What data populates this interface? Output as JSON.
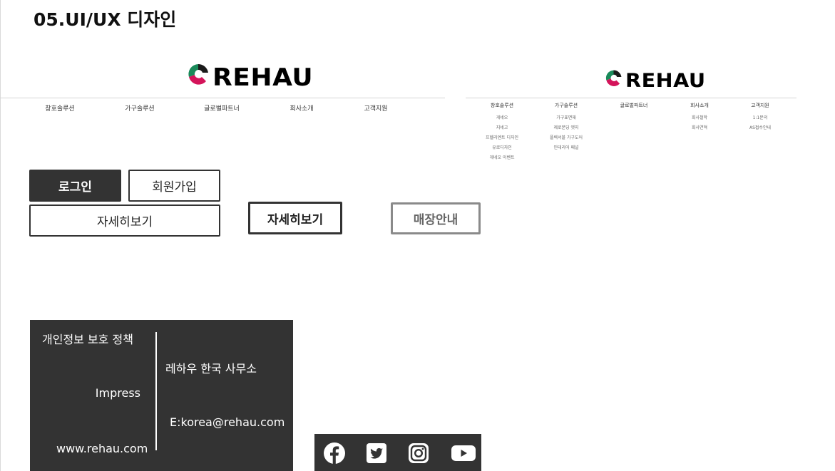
{
  "page": {
    "title": "05.UI/UX 디자인"
  },
  "brand": {
    "name": "REHAU",
    "colors": {
      "green": "#1a8a5a",
      "red": "#d4145a",
      "dark": "#333333"
    }
  },
  "header_large": {
    "nav": [
      "창호솔루션",
      "가구솔루션",
      "글로벌파트너",
      "회사소개",
      "고객지원"
    ]
  },
  "header_small": {
    "menus": [
      {
        "label": "창호솔루션",
        "items": [
          "게네오",
          "지네고",
          "프헬리엔트 디자인",
          "유로디자인",
          "게네오 이벤트"
        ]
      },
      {
        "label": "가구솔루션",
        "items": [
          "가구표면재",
          "제로본딩 엣지",
          "플렉서블 가구도어",
          "인테리어 패널"
        ]
      },
      {
        "label": "글로벌파트너",
        "items": []
      },
      {
        "label": "회사소개",
        "items": [
          "회사철학",
          "회사연혁"
        ]
      },
      {
        "label": "고객지원",
        "items": [
          "1:1문의",
          "AS접수안내"
        ]
      }
    ]
  },
  "buttons": {
    "login": "로그인",
    "signup": "회원가입",
    "details_wide": "자세히보기",
    "details_bold": "자세히보기",
    "store_info": "매장안내"
  },
  "footer": {
    "privacy": "개인정보 보호 정책",
    "impress": "Impress",
    "website": "www.rehau.com",
    "office": "레하우 한국 사무소",
    "email": "E:korea@rehau.com"
  },
  "social": {
    "icons": [
      "facebook-icon",
      "twitter-icon",
      "instagram-icon",
      "youtube-icon"
    ]
  }
}
